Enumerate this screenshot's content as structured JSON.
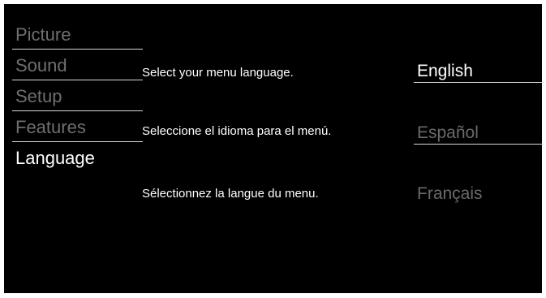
{
  "colors": {
    "background": "#000000",
    "selected_text": "#ffffff",
    "unselected_text": "#6f6f6f",
    "divider": "#d9d9d9"
  },
  "menu": {
    "selected": "Language",
    "items": [
      {
        "label": "Picture"
      },
      {
        "label": "Sound"
      },
      {
        "label": "Setup"
      },
      {
        "label": "Features"
      },
      {
        "label": "Language"
      }
    ]
  },
  "language_panel": {
    "selected": "English",
    "rows": [
      {
        "prompt": "Select your menu language.",
        "option": "English"
      },
      {
        "prompt": "Seleccione el idioma para el menú.",
        "option": "Español"
      },
      {
        "prompt": "Sélectionnez la langue du menu.",
        "option": "Français"
      }
    ]
  }
}
